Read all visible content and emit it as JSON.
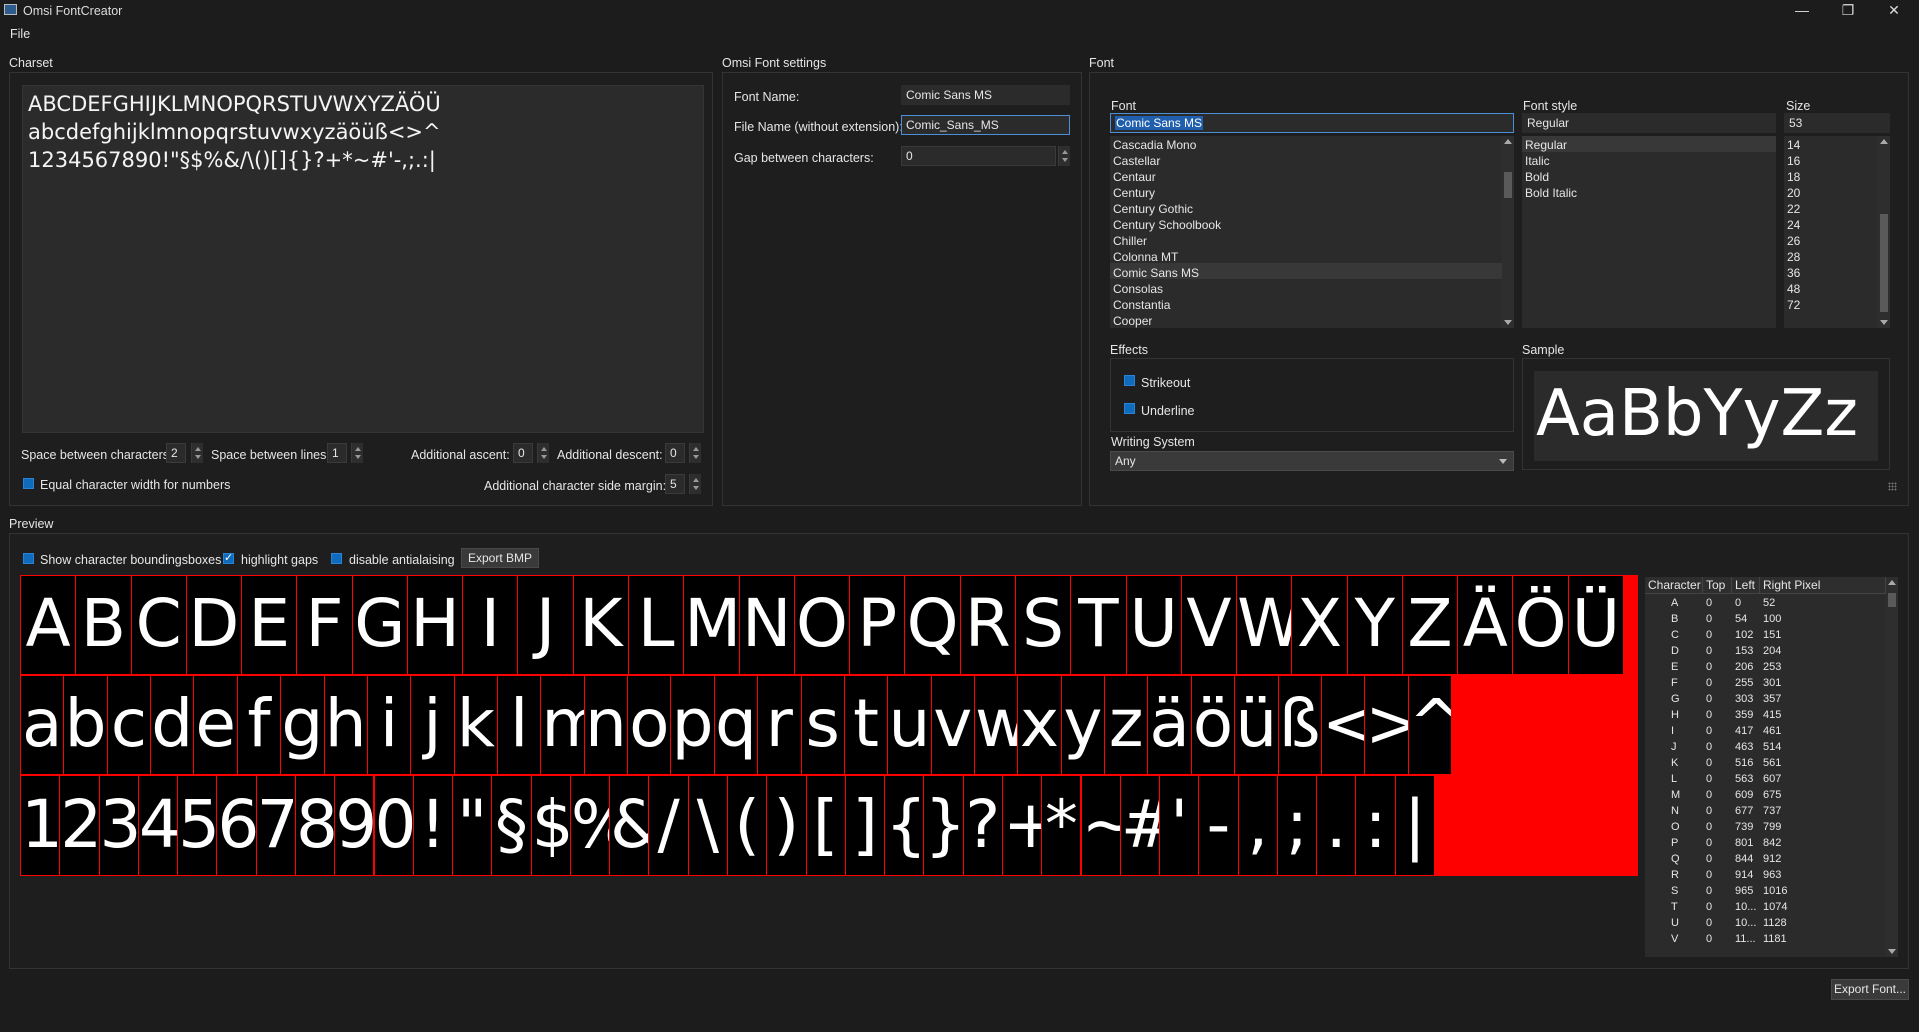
{
  "window": {
    "title": "Omsi FontCreator",
    "minimize": "—",
    "restore": "❐",
    "close": "✕"
  },
  "menu": {
    "file": "File"
  },
  "charset": {
    "section": "Charset",
    "lines": [
      "ABCDEFGHIJKLMNOPQRSTUVWXYZÄÖÜ",
      "abcdefghijklmnopqrstuvwxyzäöüß<>^",
      "1234567890!\"§$%&/\\()[]{}?+*~#'-,;.:|"
    ],
    "space_between_characters": {
      "label": "Space between characters:",
      "value": "2"
    },
    "space_between_lines": {
      "label": "Space between lines:",
      "value": "1"
    },
    "additional_ascent": {
      "label": "Additional ascent:",
      "value": "0"
    },
    "additional_descent": {
      "label": "Additional descent:",
      "value": "0"
    },
    "equal_width": {
      "label": "Equal character width for numbers"
    },
    "side_margin": {
      "label": "Additional character side margin:",
      "value": "5"
    }
  },
  "omsi": {
    "section": "Omsi Font settings",
    "font_name": {
      "label": "Font Name:",
      "value": "Comic Sans MS"
    },
    "file_name": {
      "label": "File Name (without extension):",
      "value": "Comic_Sans_MS"
    },
    "gap": {
      "label": "Gap between characters:",
      "value": "0"
    }
  },
  "font": {
    "section": "Font",
    "font_label": "Font",
    "font_value": "Comic Sans MS",
    "fonts": [
      "Cascadia Mono",
      "Castellar",
      "Centaur",
      "Century",
      "Century Gothic",
      "Century Schoolbook",
      "Chiller",
      "Colonna MT",
      "Comic Sans MS",
      "Consolas",
      "Constantia",
      "Cooper"
    ],
    "style_label": "Font style",
    "style_value": "Regular",
    "styles": [
      "Regular",
      "Italic",
      "Bold",
      "Bold Italic"
    ],
    "size_label": "Size",
    "size_value": "53",
    "sizes": [
      "14",
      "16",
      "18",
      "20",
      "22",
      "24",
      "26",
      "28",
      "36",
      "48",
      "72"
    ],
    "effects_label": "Effects",
    "strikeout": "Strikeout",
    "underline": "Underline",
    "sample_label": "Sample",
    "sample_text": "AaBbYyZz",
    "writing_system_label": "Writing System",
    "writing_system_value": "Any"
  },
  "preview": {
    "section": "Preview",
    "show_bbox": "Show character boundingsboxes",
    "highlight_gaps": "highlight gaps",
    "disable_aa": "disable antialaising",
    "export_bmp": "Export BMP",
    "rows": [
      [
        "A",
        "B",
        "C",
        "D",
        "E",
        "F",
        "G",
        "H",
        "I",
        "J",
        "K",
        "L",
        "M",
        "N",
        "O",
        "P",
        "Q",
        "R",
        "S",
        "T",
        "U",
        "V",
        "W",
        "X",
        "Y",
        "Z",
        "Ä",
        "Ö",
        "Ü"
      ],
      [
        "a",
        "b",
        "c",
        "d",
        "e",
        "f",
        "g",
        "h",
        "i",
        "j",
        "k",
        "l",
        "m",
        "n",
        "o",
        "p",
        "q",
        "r",
        "s",
        "t",
        "u",
        "v",
        "w",
        "x",
        "y",
        "z",
        "ä",
        "ö",
        "ü",
        "ß",
        "<",
        ">",
        "^"
      ],
      [
        "1",
        "2",
        "3",
        "4",
        "5",
        "6",
        "7",
        "8",
        "9",
        "0",
        "!",
        "\"",
        "§",
        "$",
        "%",
        "&",
        "/",
        "\\",
        "(",
        ")",
        "[",
        "]",
        "{",
        "}",
        "?",
        "+",
        "*",
        "~",
        "#",
        "'",
        "-",
        ",",
        ";",
        ".",
        ":",
        "|"
      ]
    ]
  },
  "table": {
    "headers": [
      "Character",
      "Top",
      "Left",
      "Right Pixel"
    ],
    "rows": [
      [
        "A",
        "0",
        "0",
        "52"
      ],
      [
        "B",
        "0",
        "54",
        "100"
      ],
      [
        "C",
        "0",
        "102",
        "151"
      ],
      [
        "D",
        "0",
        "153",
        "204"
      ],
      [
        "E",
        "0",
        "206",
        "253"
      ],
      [
        "F",
        "0",
        "255",
        "301"
      ],
      [
        "G",
        "0",
        "303",
        "357"
      ],
      [
        "H",
        "0",
        "359",
        "415"
      ],
      [
        "I",
        "0",
        "417",
        "461"
      ],
      [
        "J",
        "0",
        "463",
        "514"
      ],
      [
        "K",
        "0",
        "516",
        "561"
      ],
      [
        "L",
        "0",
        "563",
        "607"
      ],
      [
        "M",
        "0",
        "609",
        "675"
      ],
      [
        "N",
        "0",
        "677",
        "737"
      ],
      [
        "O",
        "0",
        "739",
        "799"
      ],
      [
        "P",
        "0",
        "801",
        "842"
      ],
      [
        "Q",
        "0",
        "844",
        "912"
      ],
      [
        "R",
        "0",
        "914",
        "963"
      ],
      [
        "S",
        "0",
        "965",
        "1016"
      ],
      [
        "T",
        "0",
        "10...",
        "1074"
      ],
      [
        "U",
        "0",
        "10...",
        "1128"
      ],
      [
        "V",
        "0",
        "11...",
        "1181"
      ]
    ]
  },
  "export_font": "Export Font..."
}
